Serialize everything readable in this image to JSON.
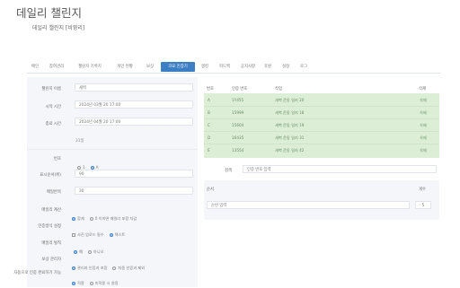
{
  "title": "데일리 챌린지",
  "subtitle": "데일리 챌린지 [비영리]",
  "tabs": [
    {
      "label": "메인"
    },
    {
      "label": "참여관리"
    },
    {
      "label": "챌린지 기록지"
    },
    {
      "label": "개인 현황"
    },
    {
      "label": "보상"
    },
    {
      "label": "코요 인증기"
    },
    {
      "label": "랭킹"
    },
    {
      "label": "피드백"
    },
    {
      "label": "공지사항"
    },
    {
      "label": "후원"
    },
    {
      "label": "설정"
    },
    {
      "label": "로그"
    }
  ],
  "form": {
    "name_label": "챌린지 이름",
    "name_value": "새벽",
    "start_label": "시작 시간",
    "start_value": "2024년 03월 20 17:00",
    "end_label": "종료 시간",
    "end_value": "2024년 04월 20 17:00",
    "duration_text": "31일",
    "number_label": "번호",
    "number_options": [
      "1",
      "A"
    ],
    "order_label": "표시순서(위)",
    "order_value": "90",
    "repeat_label": "매일반복",
    "repeat_value": "30",
    "daily_calc_label": "매일리 계산",
    "daily_calc_options": [
      "합계",
      "0 이하면 매일리 포함 차감"
    ],
    "rule_label": "인증방식 설정",
    "rule_options": [
      "사진 업로드 필수",
      "텍스트"
    ],
    "daily_penalty_label": "매일리 벌칙",
    "daily_penalty_options": [
      "예",
      "아니오"
    ],
    "reward_label": "보상 관리자",
    "reward_options": [
      "관리자 인증과 포함",
      "자동 인증과 제외"
    ],
    "auto_label": "자동으로 인증 완료하기 가능",
    "auto_options": [
      "적용",
      "미적용 시 설정"
    ]
  },
  "table": {
    "headers": [
      "번호",
      "인증 번호",
      "작업",
      "삭제"
    ],
    "rows": [
      {
        "no": "A",
        "code": "1Y455",
        "desc": "새벽 운동 일지 20",
        "action": "삭제"
      },
      {
        "no": "B",
        "code": "15999",
        "desc": "새벽 운동 일지 18",
        "action": "삭제"
      },
      {
        "no": "C",
        "code": "15604",
        "desc": "새벽 운동 일지 19",
        "action": "삭제"
      },
      {
        "no": "D",
        "code": "16435",
        "desc": "새벽 운동 일지 31",
        "action": "삭제"
      },
      {
        "no": "E",
        "code": "13554",
        "desc": "새벽 운동 일지 42",
        "action": "삭제"
      }
    ]
  },
  "filter": {
    "label": "검색",
    "placeholder": "인증 번호 입력"
  },
  "order_section": {
    "label": "순서",
    "count_label": "개수",
    "input_value": "순번 입력",
    "count_value": "5"
  },
  "colors": {
    "accent": "#3c7fc4",
    "row_bg": "#dcefd6",
    "panel_bg": "#f4f6f9"
  }
}
